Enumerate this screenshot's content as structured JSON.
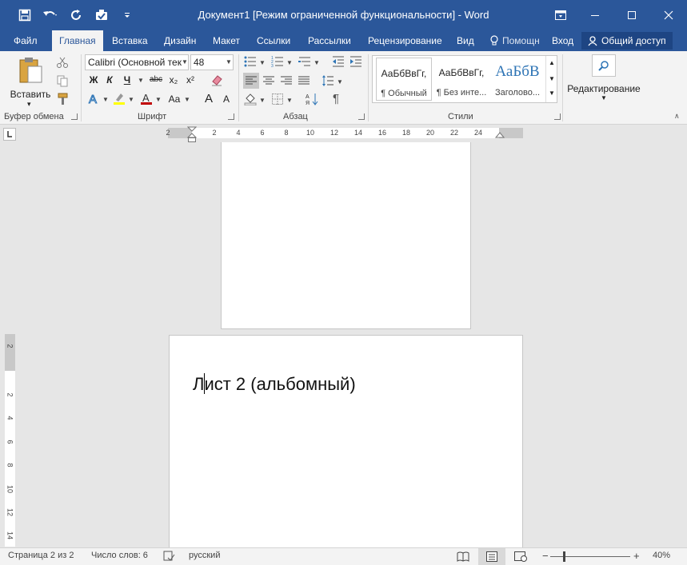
{
  "window": {
    "title": "Документ1 [Режим ограниченной функциональности] - Word"
  },
  "tabs": {
    "file": "Файл",
    "home": "Главная",
    "insert": "Вставка",
    "design": "Дизайн",
    "layout": "Макет",
    "references": "Ссылки",
    "mailings": "Рассылки",
    "review": "Рецензирование",
    "view": "Вид",
    "help": "Помощн",
    "login": "Вход",
    "share": "Общий доступ"
  },
  "ribbon": {
    "clipboard": {
      "paste_label": "Вставить",
      "group_label": "Буфер обмена"
    },
    "font": {
      "font_name": "Calibri (Основной тек",
      "font_size": "48",
      "bold": "Ж",
      "italic": "К",
      "underline": "Ч",
      "strike": "abc",
      "subscript": "x₂",
      "superscript": "x²",
      "change_case": "Aa",
      "grow": "A",
      "shrink": "A",
      "group_label": "Шрифт",
      "font_color": "#c00000",
      "highlight_color": "#ffff00"
    },
    "paragraph": {
      "group_label": "Абзац",
      "pilcrow": "¶"
    },
    "styles": {
      "group_label": "Стили",
      "items": [
        {
          "preview": "АаБбВвГг,",
          "name": "¶ Обычный"
        },
        {
          "preview": "АаБбВвГг,",
          "name": "¶ Без инте..."
        },
        {
          "preview": "АаБбВ",
          "name": "Заголово..."
        }
      ]
    },
    "editing": {
      "label": "Редактирование"
    }
  },
  "ruler": {
    "horizontal": [
      "2",
      "2",
      "4",
      "6",
      "8",
      "10",
      "12",
      "14",
      "16",
      "18",
      "20",
      "22",
      "24"
    ],
    "vertical": [
      "2",
      "2",
      "4",
      "6",
      "8",
      "10",
      "12",
      "14"
    ]
  },
  "document": {
    "page2_text_a": "Л",
    "page2_text_b": "ист 2 (альбомный)"
  },
  "statusbar": {
    "page": "Страница 2 из 2",
    "words": "Число слов: 6",
    "language": "русский",
    "zoom": "40%",
    "zoom_level_percent": 40
  },
  "colors": {
    "title_bar": "#2b579a",
    "ribbon_bg": "#f3f3f3",
    "canvas_bg": "#e6e6e6"
  }
}
